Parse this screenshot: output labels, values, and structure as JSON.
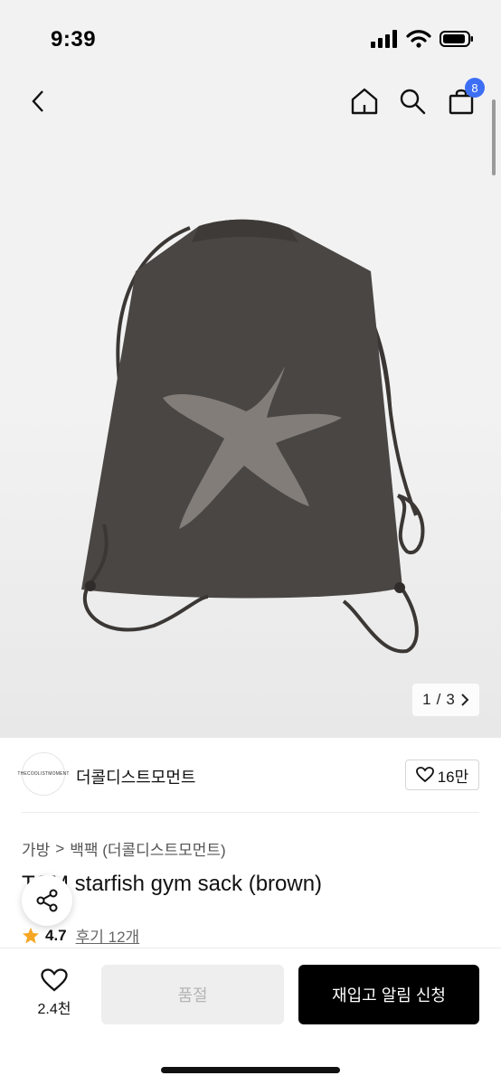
{
  "status_bar": {
    "time": "9:39"
  },
  "nav": {
    "cart_count": "8"
  },
  "gallery": {
    "current": "1",
    "separator": "/",
    "total": "3"
  },
  "brand": {
    "logo_text": "THECOOLISTMOMENT",
    "name": "더콜디스트모먼트",
    "likes": "16만"
  },
  "breadcrumb": {
    "category": "가방",
    "separator": ">",
    "subcategory": "백팩 (더콜디스트모먼트)"
  },
  "product": {
    "title": "TCM starfish gym sack (brown)"
  },
  "rating": {
    "value": "4.7",
    "reviews": "후기 12개"
  },
  "bottom_bar": {
    "wish_count": "2.4천",
    "soldout_label": "품절",
    "restock_label": "재입고 알림 신청"
  },
  "colors": {
    "badge": "#3d6ff5",
    "primary_button": "#000000",
    "disabled_button": "#eeeeee",
    "star": "#f5a623"
  }
}
